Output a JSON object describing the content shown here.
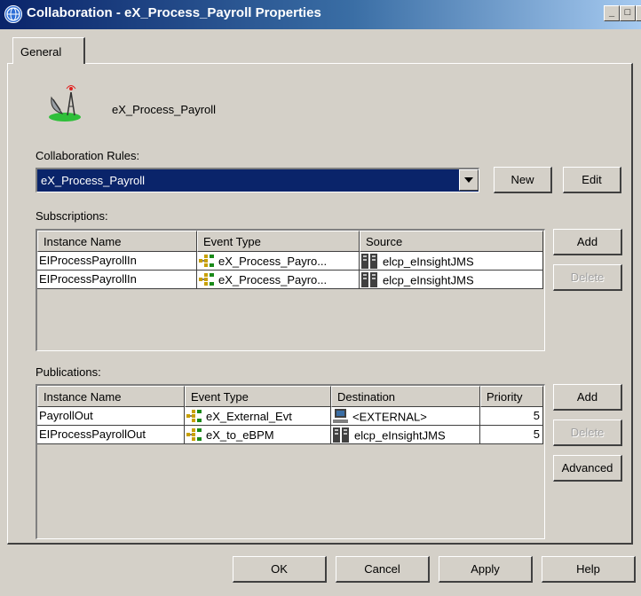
{
  "window": {
    "title": "Collaboration - eX_Process_Payroll Properties",
    "controls": {
      "minimize": "_",
      "maximize": "□",
      "close": "×"
    }
  },
  "tabs": [
    {
      "label": "General"
    }
  ],
  "collaboration": {
    "name": "eX_Process_Payroll",
    "icon": "antenna-dish-icon"
  },
  "rules": {
    "label": "Collaboration Rules:",
    "selected": "eX_Process_Payroll",
    "new_label": "New",
    "edit_label": "Edit"
  },
  "subscriptions": {
    "label": "Subscriptions:",
    "columns": [
      "Instance Name",
      "Event Type",
      "Source"
    ],
    "rows": [
      {
        "instance": "EIProcessPayrollIn",
        "event": "eX_Process_Payro...",
        "source": "elcp_eInsightJMS"
      },
      {
        "instance": "EIProcessPayrollIn",
        "event": "eX_Process_Payro...",
        "source": "elcp_eInsightJMS"
      }
    ],
    "add_label": "Add",
    "delete_label": "Delete"
  },
  "publications": {
    "label": "Publications:",
    "columns": [
      "Instance Name",
      "Event Type",
      "Destination",
      "Priority"
    ],
    "rows": [
      {
        "instance": "PayrollOut",
        "event": "eX_External_Evt",
        "destination": "<EXTERNAL>",
        "dest_icon": "computer-icon",
        "priority": "5"
      },
      {
        "instance": "EIProcessPayrollOut",
        "event": "eX_to_eBPM",
        "destination": "elcp_eInsightJMS",
        "dest_icon": "server-icon",
        "priority": "5"
      }
    ],
    "add_label": "Add",
    "delete_label": "Delete",
    "advanced_label": "Advanced"
  },
  "footer": {
    "ok": "OK",
    "cancel": "Cancel",
    "apply": "Apply",
    "help": "Help"
  }
}
